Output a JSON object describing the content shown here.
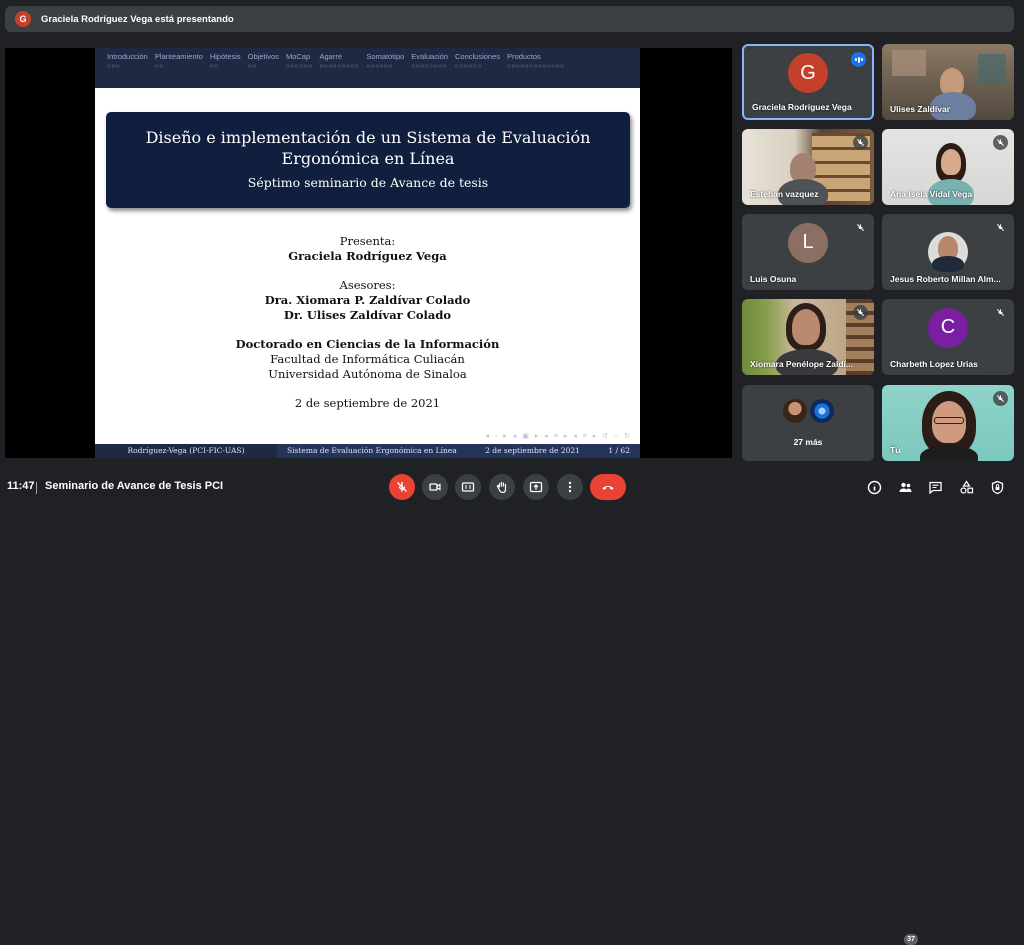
{
  "presenter_banner": {
    "initial": "G",
    "text": "Graciela Rodríguez Vega está presentando"
  },
  "slide": {
    "nav": [
      {
        "label": "Introducción",
        "dots": "○○○"
      },
      {
        "label": "Planteamiento",
        "dots": "○○"
      },
      {
        "label": "Hipótesis",
        "dots": "○○"
      },
      {
        "label": "Objetivos",
        "dots": "○○"
      },
      {
        "label": "MoCap",
        "dots": "○○○○○○"
      },
      {
        "label": "Agarre",
        "dots": "○○○○○○○○○"
      },
      {
        "label": "Somatotipo",
        "dots": "○○○○○○"
      },
      {
        "label": "Evaluación",
        "dots": "○○○○○○○○"
      },
      {
        "label": "Conclusiones",
        "dots": "○○○○○○"
      },
      {
        "label": "Productos",
        "dots": "○○○○○○○○○○○○○"
      }
    ],
    "title": "Diseño e implementación de un Sistema de Evaluación Ergonómica en Línea",
    "subtitle": "Séptimo seminario de Avance de tesis",
    "presenta_label": "Presenta:",
    "presenter": "Graciela Rodríguez Vega",
    "asesores_label": "Asesores:",
    "advisor1": "Dra. Xiomara P. Zaldívar Colado",
    "advisor2": "Dr. Ulises Zaldívar Colado",
    "program": "Doctorado en Ciencias de la Información",
    "faculty": "Facultad de Informática Culiacán",
    "university": "Universidad Autónoma de Sinaloa",
    "date": "2 de septiembre de 2021",
    "footer_left": "Rodríguez-Vega (PCI-FIC-UAS)",
    "footer_title": "Sistema de Evaluación Ergonómica en Línea",
    "footer_date": "2 de septiembre de 2021",
    "footer_page": "1 / 62"
  },
  "participants": [
    {
      "name": "Graciela Rodríguez Vega",
      "initial": "G",
      "avatar_color": "#c5402b",
      "state": "speaking"
    },
    {
      "name": "Ulises Zaldívar",
      "state": "video"
    },
    {
      "name": "Esteban vazquez",
      "state": "video-muted"
    },
    {
      "name": "Ana Isela Vidal Vega",
      "state": "video-muted"
    },
    {
      "name": "Luis Osuna",
      "initial": "L",
      "avatar_color": "#8d6e63",
      "state": "muted"
    },
    {
      "name": "Jesus Roberto Millan Alm...",
      "state": "video-muted"
    },
    {
      "name": "Xiomara Penélope Zaldí...",
      "state": "video-muted"
    },
    {
      "name": "Charbeth Lopez Urias",
      "initial": "C",
      "avatar_color": "#7b1fa2",
      "state": "muted"
    },
    {
      "name": "27 más",
      "state": "more"
    },
    {
      "name": "Tú",
      "state": "video-muted"
    }
  ],
  "bottom": {
    "time": "11:47",
    "meeting_name": "Seminario de Avance de Tesis PCI",
    "people_count": "37"
  },
  "colors": {
    "accent": "#8ab4f8",
    "danger": "#ea4335",
    "slide_navy": "#0f1f3d"
  }
}
